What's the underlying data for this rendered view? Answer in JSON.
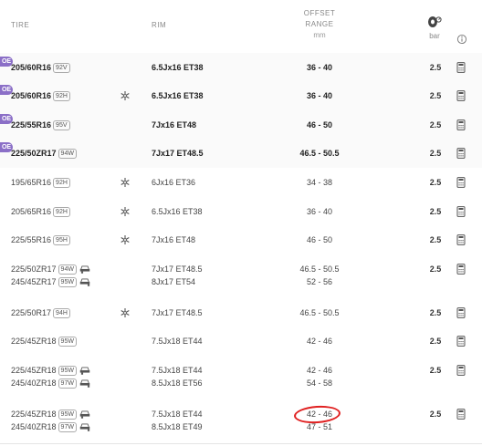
{
  "header": {
    "tire": "TIRE",
    "rim": "RIM",
    "offset_line1": "OFFSET",
    "offset_line2": "RANGE",
    "offset_unit": "mm",
    "pressure_unit": "bar",
    "pressure_icon": "tire-pressure-icon",
    "info_icon": "info-icon"
  },
  "oe_label": "OE",
  "rows": [
    {
      "oe": true,
      "bold": true,
      "snow": false,
      "tires": [
        {
          "size": "205/60R16",
          "load": "92V"
        }
      ],
      "rims": [
        "6.5Jx16 ET38"
      ],
      "offsets": [
        "36 - 40"
      ],
      "pressure": "2.5"
    },
    {
      "oe": true,
      "bold": true,
      "snow": true,
      "tires": [
        {
          "size": "205/60R16",
          "load": "92H"
        }
      ],
      "rims": [
        "6.5Jx16 ET38"
      ],
      "offsets": [
        "36 - 40"
      ],
      "pressure": "2.5"
    },
    {
      "oe": true,
      "bold": true,
      "snow": false,
      "tires": [
        {
          "size": "225/55R16",
          "load": "95V"
        }
      ],
      "rims": [
        "7Jx16 ET48"
      ],
      "offsets": [
        "46 - 50"
      ],
      "pressure": "2.5"
    },
    {
      "oe": true,
      "bold": true,
      "snow": false,
      "tires": [
        {
          "size": "225/50ZR17",
          "load": "94W"
        }
      ],
      "rims": [
        "7Jx17 ET48.5"
      ],
      "offsets": [
        "46.5 - 50.5"
      ],
      "pressure": "2.5"
    },
    {
      "oe": false,
      "bold": false,
      "snow": true,
      "tires": [
        {
          "size": "195/65R16",
          "load": "92H"
        }
      ],
      "rims": [
        "6Jx16 ET36"
      ],
      "offsets": [
        "34 - 38"
      ],
      "pressure": "2.5"
    },
    {
      "oe": false,
      "bold": false,
      "snow": true,
      "tires": [
        {
          "size": "205/65R16",
          "load": "92H"
        }
      ],
      "rims": [
        "6.5Jx16 ET38"
      ],
      "offsets": [
        "36 - 40"
      ],
      "pressure": "2.5"
    },
    {
      "oe": false,
      "bold": false,
      "snow": true,
      "tires": [
        {
          "size": "225/55R16",
          "load": "95H"
        }
      ],
      "rims": [
        "7Jx16 ET48"
      ],
      "offsets": [
        "46 - 50"
      ],
      "pressure": "2.5"
    },
    {
      "oe": false,
      "bold": false,
      "snow": false,
      "tires": [
        {
          "size": "225/50ZR17",
          "load": "94W",
          "axle": "front"
        },
        {
          "size": "245/45ZR17",
          "load": "95W",
          "axle": "rear"
        }
      ],
      "rims": [
        "7Jx17 ET48.5",
        "8Jx17 ET54"
      ],
      "offsets": [
        "46.5 - 50.5",
        "52 - 56"
      ],
      "pressure": "2.5"
    },
    {
      "oe": false,
      "bold": false,
      "snow": true,
      "tires": [
        {
          "size": "225/50R17",
          "load": "94H"
        }
      ],
      "rims": [
        "7Jx17 ET48.5"
      ],
      "offsets": [
        "46.5 - 50.5"
      ],
      "pressure": "2.5"
    },
    {
      "oe": false,
      "bold": false,
      "snow": false,
      "tires": [
        {
          "size": "225/45ZR18",
          "load": "95W"
        }
      ],
      "rims": [
        "7.5Jx18 ET44"
      ],
      "offsets": [
        "42 - 46"
      ],
      "pressure": "2.5"
    },
    {
      "oe": false,
      "bold": false,
      "snow": false,
      "tires": [
        {
          "size": "225/45ZR18",
          "load": "95W",
          "axle": "front"
        },
        {
          "size": "245/40ZR18",
          "load": "97W",
          "axle": "rear"
        }
      ],
      "rims": [
        "7.5Jx18 ET44",
        "8.5Jx18 ET56"
      ],
      "offsets": [
        "42 - 46",
        "54 - 58"
      ],
      "pressure": "2.5"
    },
    {
      "oe": false,
      "bold": false,
      "snow": false,
      "tires": [
        {
          "size": "225/45ZR18",
          "load": "95W",
          "axle": "front"
        },
        {
          "size": "245/40ZR18",
          "load": "97W",
          "axle": "rear"
        }
      ],
      "rims": [
        "7.5Jx18 ET44",
        "8.5Jx18 ET49"
      ],
      "offsets": [
        "42 - 46",
        "47 - 51"
      ],
      "pressure": "2.5",
      "highlight": "42 - 46"
    }
  ],
  "colors": {
    "oe_badge": "#8b6fc7",
    "highlight": "#e02020",
    "text": "#333333"
  },
  "icons": {
    "snow": "snowflake-icon",
    "calculator": "calculator-icon",
    "front_axle": "front-axle-car-icon",
    "rear_axle": "rear-axle-car-icon"
  }
}
